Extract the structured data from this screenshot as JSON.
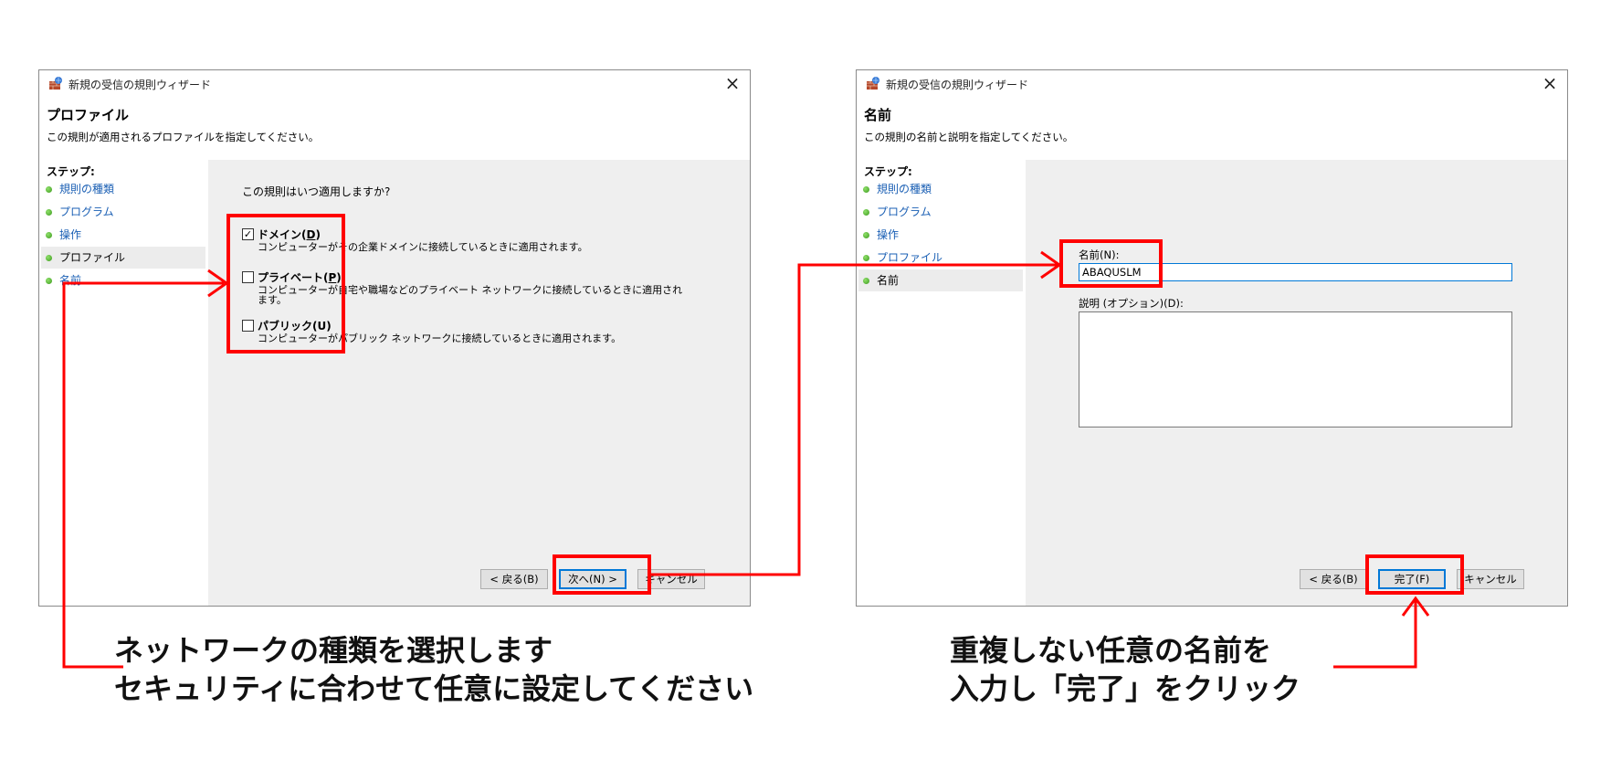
{
  "window1": {
    "title": "新規の受信の規則ウィザード",
    "header_title": "プロファイル",
    "header_desc": "この規則が適用されるプロファイルを指定してください。",
    "steps_title": "ステップ:",
    "steps": [
      "規則の種類",
      "プログラム",
      "操作",
      "プロファイル",
      "名前"
    ],
    "question": "この規則はいつ適用しますか?",
    "options": [
      {
        "label_main": "ドメイン(",
        "label_key": "D",
        "checked_mark": "✓",
        "desc": "コンピューターがその企業ドメインに接続しているときに適用されます。"
      },
      {
        "label_main": "プライベート(",
        "label_key": "P",
        "checked_mark": "",
        "desc": "コンピューターが自宅や職場などのプライベート ネットワークに接続しているときに適用されます。"
      },
      {
        "label_main": "パブリック(U)",
        "label_key": "",
        "checked_mark": "",
        "desc": "コンピューターがパブリック ネットワークに接続しているときに適用されます。"
      }
    ],
    "back_label": "< 戻る(B)",
    "next_label": "次へ(N) >",
    "cancel_label": "キャンセル"
  },
  "window2": {
    "title": "新規の受信の規則ウィザード",
    "header_title": "名前",
    "header_desc": "この規則の名前と説明を指定してください。",
    "steps_title": "ステップ:",
    "steps": [
      "規則の種類",
      "プログラム",
      "操作",
      "プロファイル",
      "名前"
    ],
    "name_label": "名前(N):",
    "name_value": "ABAQUSLM",
    "desc_label": "説明 (オプション)(D):",
    "back_label": "< 戻る(B)",
    "finish_label": "完了(F)",
    "cancel_label": "キャンセル"
  },
  "captions": {
    "left_line1": "ネットワークの種類を選択します",
    "left_line2": "セキュリティに合わせて任意に設定してください",
    "right_line1": "重複しない任意の名前を",
    "right_line2": "入力し「完了」をクリック"
  },
  "colors": {
    "annotation": "#ff0000",
    "link": "#1a5fb4",
    "accent": "#0078d7"
  }
}
